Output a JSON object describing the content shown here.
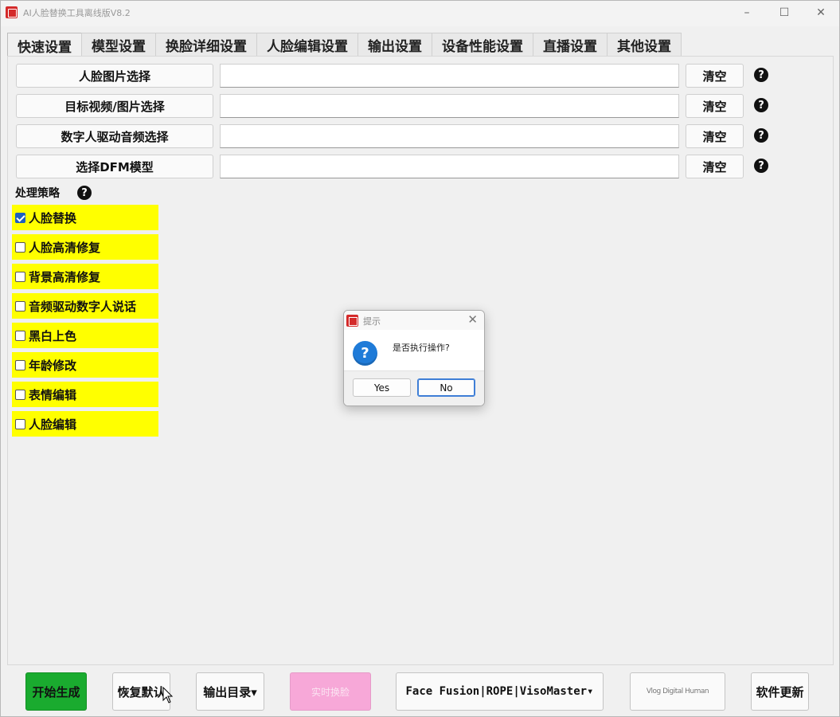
{
  "window": {
    "title": "AI人脸替换工具离线版V8.2",
    "controls": {
      "minimize": "–",
      "maximize": "☐",
      "close": "✕"
    }
  },
  "tabs": [
    "快速设置",
    "模型设置",
    "换脸详细设置",
    "人脸编辑设置",
    "输出设置",
    "设备性能设置",
    "直播设置",
    "其他设置"
  ],
  "file_rows": [
    {
      "button": "人脸图片选择",
      "value": "",
      "clear": "清空",
      "help": "?"
    },
    {
      "button": "目标视频/图片选择",
      "value": "",
      "clear": "清空",
      "help": "?"
    },
    {
      "button": "数字人驱动音频选择",
      "value": "",
      "clear": "清空",
      "help": "?"
    },
    {
      "button": "选择DFM模型",
      "value": "",
      "clear": "清空",
      "help": "?"
    }
  ],
  "strategy": {
    "label": "处理策略",
    "help": "?",
    "options": [
      {
        "label": "人脸替换",
        "checked": true
      },
      {
        "label": "人脸高清修复",
        "checked": false
      },
      {
        "label": "背景高清修复",
        "checked": false
      },
      {
        "label": "音频驱动数字人说话",
        "checked": false
      },
      {
        "label": "黑白上色",
        "checked": false
      },
      {
        "label": "年龄修改",
        "checked": false
      },
      {
        "label": "表情编辑",
        "checked": false
      },
      {
        "label": "人脸编辑",
        "checked": false
      }
    ]
  },
  "bottom": {
    "start": "开始生成",
    "restore": "恢复默认",
    "output_dir": "输出目录▾",
    "pink": "实时换脸",
    "engine": "Face Fusion|ROPE|VisoMaster▾",
    "faded": "Vlog Digital Human",
    "update": "软件更新"
  },
  "dialog": {
    "title": "提示",
    "message": "是否执行操作?",
    "yes": "Yes",
    "no": "No",
    "icon": "?",
    "close": "✕"
  },
  "colors": {
    "option_bg": "#ffff00",
    "start_bg": "#1aab2f",
    "pink_bg": "#f7a8d8",
    "dialog_icon": "#1f7bd8",
    "app_icon": "#d42a2a"
  }
}
